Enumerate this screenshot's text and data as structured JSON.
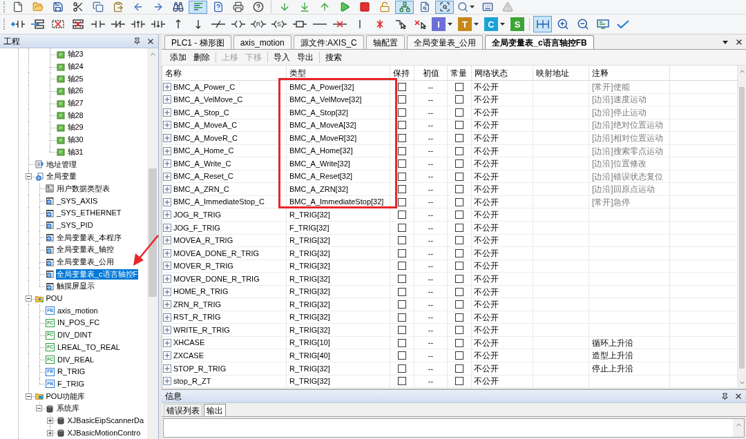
{
  "toolbar": {
    "row_1": [
      [
        {
          "kind": "new",
          "on": false
        },
        {
          "kind": "open",
          "on": false
        },
        {
          "kind": "save",
          "on": false
        },
        {
          "kind": "cut",
          "on": false
        },
        {
          "kind": "copy",
          "on": false
        },
        {
          "kind": "paste",
          "on": false
        },
        {
          "kind": "back",
          "on": false
        },
        {
          "kind": "forward",
          "on": false
        },
        {
          "kind": "find",
          "on": false
        },
        {
          "kind": "ladder",
          "on": true
        },
        {
          "kind": "helpdoc",
          "on": false
        },
        {
          "kind": "print",
          "on": false
        },
        {
          "kind": "help",
          "on": false
        }
      ],
      [
        {
          "kind": "download",
          "on": false
        },
        {
          "kind": "download_line",
          "on": false
        },
        {
          "kind": "upload",
          "on": false
        },
        {
          "kind": "run",
          "on": false
        },
        {
          "kind": "stop",
          "on": false
        },
        {
          "kind": "unlock",
          "on": false
        },
        {
          "kind": "network",
          "on": true
        },
        {
          "kind": "inspect",
          "on": false
        },
        {
          "kind": "scan",
          "on": true
        },
        {
          "kind": "zoom_menu",
          "on": false
        },
        {
          "kind": "device",
          "on": false
        },
        {
          "kind": "warning",
          "on": false
        }
      ]
    ],
    "row_2": [
      [
        {
          "kind": "add_contact",
          "on": false
        },
        {
          "kind": "insert_rung",
          "on": false
        },
        {
          "kind": "delete_contact",
          "on": false
        },
        {
          "kind": "delete_rung",
          "on": false
        },
        {
          "kind": "contact_no",
          "on": false
        },
        {
          "kind": "contact_nc",
          "on": false
        },
        {
          "kind": "contact_rise",
          "on": false
        },
        {
          "kind": "contact_fall",
          "on": false
        },
        {
          "kind": "rise",
          "on": false
        },
        {
          "kind": "fall",
          "on": false
        },
        {
          "kind": "invert",
          "on": false
        },
        {
          "kind": "coil",
          "on": false
        },
        {
          "kind": "coil_letter",
          "label": "R",
          "on": false
        },
        {
          "kind": "coil_letter",
          "label": "S",
          "on": false
        },
        {
          "kind": "block",
          "on": false
        },
        {
          "kind": "hline",
          "on": false
        },
        {
          "kind": "hline_delete",
          "on": false
        },
        {
          "kind": "vline",
          "on": false
        },
        {
          "kind": "vline_delete",
          "on": false
        },
        {
          "kind": "cursor_line",
          "on": false
        },
        {
          "kind": "cursor_delete",
          "on": false
        },
        {
          "kind": "letter",
          "label": "I",
          "color": "#6c6fd5",
          "menu": true,
          "on": false
        },
        {
          "kind": "letter",
          "label": "T",
          "color": "#c7881b",
          "menu": true,
          "on": false
        },
        {
          "kind": "letter",
          "label": "C",
          "color": "#1ba3d6",
          "menu": true,
          "on": false
        },
        {
          "kind": "letter",
          "label": "S",
          "color": "#3ca535",
          "menu": false,
          "on": false
        }
      ],
      [
        {
          "kind": "split",
          "on": true
        },
        {
          "kind": "zoom_in",
          "on": false
        },
        {
          "kind": "zoom_out",
          "on": false
        },
        {
          "kind": "monitor",
          "on": false
        },
        {
          "kind": "verify",
          "on": false
        }
      ]
    ]
  },
  "project_panel": {
    "title": "工程",
    "tree": [
      {
        "children": [
          {
            "children": [
              {
                "label": "轴23",
                "kind": "axis",
                "selected": false
              },
              {
                "label": "轴24",
                "kind": "axis",
                "selected": false
              },
              {
                "label": "轴25",
                "kind": "axis",
                "selected": false
              },
              {
                "label": "轴26",
                "kind": "axis",
                "selected": false
              },
              {
                "label": "轴27",
                "kind": "axis",
                "selected": false
              },
              {
                "label": "轴28",
                "kind": "axis",
                "selected": false
              },
              {
                "label": "轴29",
                "kind": "axis",
                "selected": false
              },
              {
                "label": "轴30",
                "kind": "axis",
                "selected": false
              },
              {
                "label": "轴31",
                "kind": "axis",
                "selected": false
              }
            ]
          }
        ]
      },
      {
        "label": "地址管理",
        "kind": "address",
        "selected": false
      },
      {
        "label": "全局变量",
        "kind": "globals",
        "expanded": true,
        "selected": false,
        "children": [
          {
            "label": "用户数据类型表",
            "kind": "types",
            "selected": false
          },
          {
            "label": "_SYS_AXIS",
            "kind": "global_table",
            "selected": false
          },
          {
            "label": "_SYS_ETHERNET",
            "kind": "global_table",
            "selected": false
          },
          {
            "label": "_SYS_PID",
            "kind": "global_table",
            "selected": false
          },
          {
            "label": "全局变量表_本程序",
            "kind": "global_table",
            "selected": false
          },
          {
            "label": "全局变量表_轴控",
            "kind": "global_table",
            "selected": false
          },
          {
            "label": "全局变量表_公用",
            "kind": "global_table",
            "selected": false
          },
          {
            "label": "全局变量表_c语言轴控F",
            "kind": "global_table",
            "selected": true
          },
          {
            "label": "触摸屏显示",
            "kind": "global_table",
            "selected": false
          }
        ]
      },
      {
        "label": "POU",
        "kind": "pou",
        "expanded": true,
        "selected": false,
        "children": [
          {
            "label": "axis_motion",
            "kind": "block",
            "badge": "FB",
            "selected": false
          },
          {
            "label": "IN_POS_FC",
            "kind": "function",
            "badge": "FC",
            "selected": false
          },
          {
            "label": "DIV_DINT",
            "kind": "function",
            "badge": "FC",
            "selected": false
          },
          {
            "label": "LREAL_TO_REAL",
            "kind": "function",
            "badge": "FC",
            "selected": false
          },
          {
            "label": "DIV_REAL",
            "kind": "function",
            "badge": "FC",
            "selected": false
          },
          {
            "label": "R_TRIG",
            "kind": "block",
            "badge": "FB",
            "selected": false
          },
          {
            "label": "F_TRIG",
            "kind": "block",
            "badge": "FB",
            "selected": false
          }
        ]
      },
      {
        "label": "POU功能库",
        "kind": "library",
        "expanded": true,
        "selected": false,
        "children": [
          {
            "label": "系统库",
            "kind": "lib",
            "expanded": true,
            "selected": false,
            "children": [
              {
                "label": "XJBasicEipScannerDa",
                "kind": "lib",
                "expanded": false,
                "selected": false
              },
              {
                "label": "XJBasicMotionContro",
                "kind": "lib",
                "expanded": false,
                "selected": false
              }
            ]
          }
        ]
      }
    ]
  },
  "editor": {
    "tabs": [
      {
        "label": "PLC1 - 梯形图",
        "selected": false
      },
      {
        "label": "axis_motion",
        "selected": false
      },
      {
        "label": "源文件:AXIS_C",
        "selected": false
      },
      {
        "label": "轴配置",
        "selected": false
      },
      {
        "label": "全局变量表_公用",
        "selected": false
      },
      {
        "label": "全局变量表_c语言轴控FB",
        "selected": true
      }
    ],
    "actions": [
      [
        {
          "label": "添加",
          "disabled": false
        },
        {
          "label": "删除",
          "disabled": false
        }
      ],
      [
        {
          "label": "上移",
          "disabled": true
        },
        {
          "label": "下移",
          "disabled": true
        }
      ],
      [
        {
          "label": "导入",
          "disabled": false
        },
        {
          "label": "导出",
          "disabled": false
        }
      ],
      [
        {
          "label": "搜索",
          "disabled": false
        }
      ]
    ],
    "table": {
      "columns": [
        "名称",
        "类型",
        "保持",
        "初值",
        "常量",
        "网络状态",
        "映射地址",
        "注释"
      ],
      "rows": [
        {
          "expanded": false,
          "name": "BMC_A_Power_C",
          "type": "BMC_A_Power[32]",
          "retain": false,
          "initial": "--",
          "constant": false,
          "network": "不公开",
          "note": "[常开]使能",
          "note_dim": true
        },
        {
          "expanded": false,
          "name": "BMC_A_VelMove_C",
          "type": "BMC_A_VelMove[32]",
          "retain": false,
          "initial": "--",
          "constant": false,
          "network": "不公开",
          "note": "[边沿]速度运动",
          "note_dim": true
        },
        {
          "expanded": false,
          "name": "BMC_A_Stop_C",
          "type": "BMC_A_Stop[32]",
          "retain": false,
          "initial": "--",
          "constant": false,
          "network": "不公开",
          "note": "[边沿]停止运动",
          "note_dim": true
        },
        {
          "expanded": false,
          "name": "BMC_A_MoveA_C",
          "type": "BMC_A_MoveA[32]",
          "retain": false,
          "initial": "--",
          "constant": false,
          "network": "不公开",
          "note": "[边沿]绝对位置运动",
          "note_dim": true
        },
        {
          "expanded": false,
          "name": "BMC_A_MoveR_C",
          "type": "BMC_A_MoveR[32]",
          "retain": false,
          "initial": "--",
          "constant": false,
          "network": "不公开",
          "note": "[边沿]相对位置运动",
          "note_dim": true
        },
        {
          "expanded": false,
          "name": "BMC_A_Home_C",
          "type": "BMC_A_Home[32]",
          "retain": false,
          "initial": "--",
          "constant": false,
          "network": "不公开",
          "note": "[边沿]搜索零点运动",
          "note_dim": true
        },
        {
          "expanded": false,
          "name": "BMC_A_Write_C",
          "type": "BMC_A_Write[32]",
          "retain": false,
          "initial": "--",
          "constant": false,
          "network": "不公开",
          "note": "[边沿]位置修改",
          "note_dim": true
        },
        {
          "expanded": false,
          "name": "BMC_A_Reset_C",
          "type": "BMC_A_Reset[32]",
          "retain": false,
          "initial": "--",
          "constant": false,
          "network": "不公开",
          "note": "[边沿]错误状态复位",
          "note_dim": true
        },
        {
          "expanded": false,
          "name": "BMC_A_ZRN_C",
          "type": "BMC_A_ZRN[32]",
          "retain": false,
          "initial": "--",
          "constant": false,
          "network": "不公开",
          "note": "[边沿]回原点运动",
          "note_dim": true
        },
        {
          "expanded": false,
          "name": "BMC_A_ImmediateStop_C",
          "type": "BMC_A_ImmediateStop[32]",
          "retain": false,
          "initial": "--",
          "constant": false,
          "network": "不公开",
          "note": "[常开]急停",
          "note_dim": true
        },
        {
          "expanded": false,
          "name": "JOG_R_TRIG",
          "type": "R_TRIG[32]",
          "retain": false,
          "initial": "--",
          "constant": false,
          "network": "不公开"
        },
        {
          "expanded": false,
          "name": "JOG_F_TRIG",
          "type": "F_TRIG[32]",
          "retain": false,
          "initial": "--",
          "constant": false,
          "network": "不公开"
        },
        {
          "expanded": false,
          "name": "MOVEA_R_TRIG",
          "type": "R_TRIG[32]",
          "retain": false,
          "initial": "--",
          "constant": false,
          "network": "不公开"
        },
        {
          "expanded": false,
          "name": "MOVEA_DONE_R_TRIG",
          "type": "R_TRIG[32]",
          "retain": false,
          "initial": "--",
          "constant": false,
          "network": "不公开"
        },
        {
          "expanded": false,
          "name": "MOVER_R_TRIG",
          "type": "R_TRIG[32]",
          "retain": false,
          "initial": "--",
          "constant": false,
          "network": "不公开"
        },
        {
          "expanded": false,
          "name": "MOVER_DONE_R_TRIG",
          "type": "R_TRIG[32]",
          "retain": false,
          "initial": "--",
          "constant": false,
          "network": "不公开"
        },
        {
          "expanded": false,
          "name": "HOME_R_TRIG",
          "type": "R_TRIG[32]",
          "retain": false,
          "initial": "--",
          "constant": false,
          "network": "不公开"
        },
        {
          "expanded": false,
          "name": "ZRN_R_TRIG",
          "type": "R_TRIG[32]",
          "retain": false,
          "initial": "--",
          "constant": false,
          "network": "不公开"
        },
        {
          "expanded": false,
          "name": "RST_R_TRIG",
          "type": "R_TRIG[32]",
          "retain": false,
          "initial": "--",
          "constant": false,
          "network": "不公开"
        },
        {
          "expanded": false,
          "name": "WRITE_R_TRIG",
          "type": "R_TRIG[32]",
          "retain": false,
          "initial": "--",
          "constant": false,
          "network": "不公开"
        },
        {
          "expanded": false,
          "name": "XHCASE",
          "type": "R_TRIG[10]",
          "retain": false,
          "initial": "--",
          "constant": false,
          "network": "不公开",
          "note": "循环上升沿",
          "note_dim": false
        },
        {
          "expanded": false,
          "name": "ZXCASE",
          "type": "R_TRIG[40]",
          "retain": false,
          "initial": "--",
          "constant": false,
          "network": "不公开",
          "note": "造型上升沿",
          "note_dim": false
        },
        {
          "expanded": false,
          "name": "STOP_R_TRIG",
          "type": "R_TRIG[32]",
          "retain": false,
          "initial": "--",
          "constant": false,
          "network": "不公开",
          "note": "停止上升沿",
          "note_dim": false
        },
        {
          "expanded": false,
          "name": "stop_R_ZT",
          "type": "R_TRIG[32]",
          "retain": false,
          "initial": "--",
          "constant": false,
          "network": "不公开"
        }
      ]
    }
  },
  "info_panel": {
    "title": "信息",
    "tabs": [
      {
        "label": "错误列表",
        "selected": false
      },
      {
        "label": "输出",
        "selected": true
      }
    ]
  },
  "annotations": {
    "frame": true,
    "arrow": true
  }
}
